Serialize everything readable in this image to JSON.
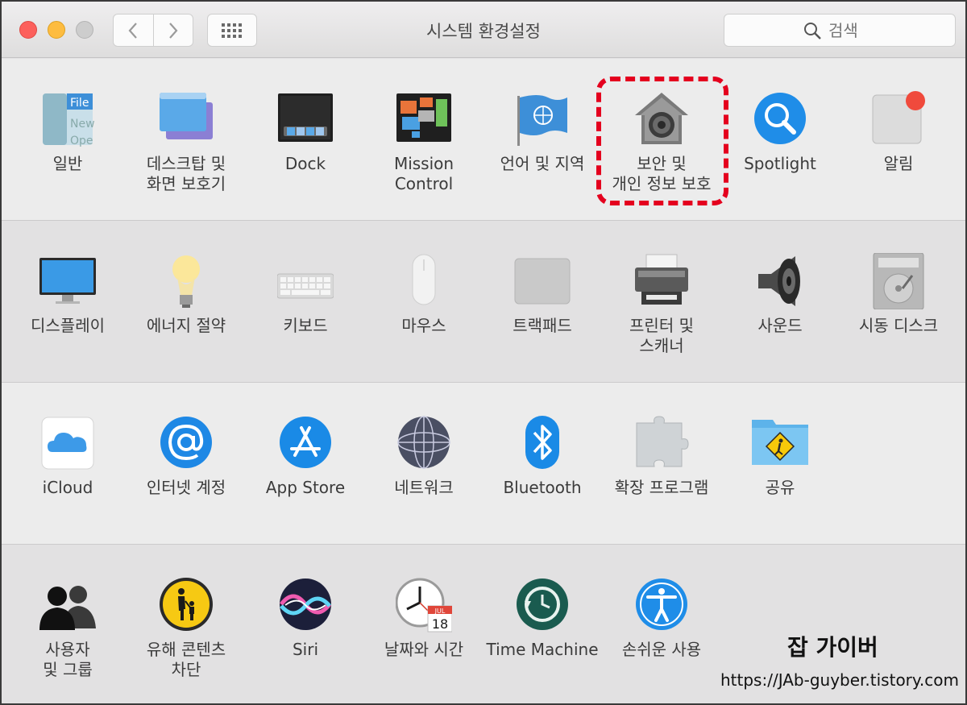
{
  "window": {
    "title": "시스템 환경설정",
    "search_placeholder": "검색"
  },
  "rows": [
    {
      "panes": [
        {
          "label": "일반",
          "icon": "general-icon"
        },
        {
          "label": "데스크탑 및\n화면 보호기",
          "icon": "desktop-screensaver-icon"
        },
        {
          "label": "Dock",
          "icon": "dock-icon"
        },
        {
          "label": "Mission\nControl",
          "icon": "mission-control-icon"
        },
        {
          "label": "언어 및 지역",
          "icon": "language-region-icon"
        },
        {
          "label": "보안 및\n개인 정보 보호",
          "icon": "security-privacy-icon"
        },
        {
          "label": "Spotlight",
          "icon": "spotlight-icon"
        },
        {
          "label": "알림",
          "icon": "notifications-icon"
        }
      ]
    },
    {
      "panes": [
        {
          "label": "디스플레이",
          "icon": "displays-icon"
        },
        {
          "label": "에너지 절약",
          "icon": "energy-saver-icon"
        },
        {
          "label": "키보드",
          "icon": "keyboard-icon"
        },
        {
          "label": "마우스",
          "icon": "mouse-icon"
        },
        {
          "label": "트랙패드",
          "icon": "trackpad-icon"
        },
        {
          "label": "프린터 및\n스캐너",
          "icon": "printer-scanner-icon"
        },
        {
          "label": "사운드",
          "icon": "sound-icon"
        },
        {
          "label": "시동 디스크",
          "icon": "startup-disk-icon"
        }
      ]
    },
    {
      "panes": [
        {
          "label": "iCloud",
          "icon": "icloud-icon"
        },
        {
          "label": "인터넷 계정",
          "icon": "internet-accounts-icon"
        },
        {
          "label": "App Store",
          "icon": "app-store-icon"
        },
        {
          "label": "네트워크",
          "icon": "network-icon"
        },
        {
          "label": "Bluetooth",
          "icon": "bluetooth-icon"
        },
        {
          "label": "확장 프로그램",
          "icon": "extensions-icon"
        },
        {
          "label": "공유",
          "icon": "sharing-icon"
        }
      ]
    },
    {
      "panes": [
        {
          "label": "사용자\n및 그룹",
          "icon": "users-groups-icon"
        },
        {
          "label": "유해 콘텐츠\n차단",
          "icon": "parental-controls-icon"
        },
        {
          "label": "Siri",
          "icon": "siri-icon"
        },
        {
          "label": "날짜와 시간",
          "icon": "date-time-icon"
        },
        {
          "label": "Time Machine",
          "icon": "time-machine-icon"
        },
        {
          "label": "손쉬운 사용",
          "icon": "accessibility-icon"
        }
      ]
    }
  ],
  "icon_text": {
    "general_file": "File",
    "general_new": "New",
    "general_open": "Ope",
    "calendar_month": "JUL",
    "calendar_day": "18"
  },
  "watermark": {
    "title": "잡 가이버",
    "url": "https://JAb-guyber.tistory.com"
  },
  "colors": {
    "highlight": "#e4001e",
    "close": "#fc605c",
    "minimize": "#fdbc40",
    "maximize": "#cdcdcd"
  }
}
